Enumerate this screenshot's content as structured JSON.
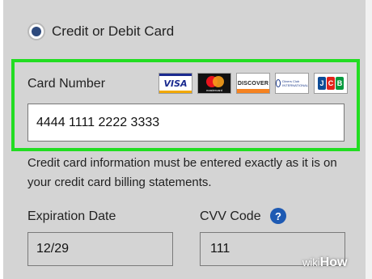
{
  "payment_method": {
    "option_label": "Credit or Debit Card",
    "selected": true
  },
  "card_number": {
    "label": "Card Number",
    "value": "4444 1111 2222 3333"
  },
  "card_logos": [
    {
      "name": "visa-logo",
      "text": "VISA"
    },
    {
      "name": "mastercard-logo",
      "text": "mastercard"
    },
    {
      "name": "discover-logo",
      "text": "DISCOVER"
    },
    {
      "name": "diners-club-logo",
      "text": "Diners Club INTERNATIONAL"
    },
    {
      "name": "jcb-logo",
      "text": "JCB"
    }
  ],
  "info_text": "Credit card information must be entered exactly as it is on your credit card billing statements.",
  "expiration": {
    "label": "Expiration Date",
    "value": "12/29"
  },
  "cvv": {
    "label": "CVV Code",
    "help_icon": "?",
    "value": "111"
  },
  "watermark": {
    "prefix": "wiki",
    "suffix": "How"
  },
  "colors": {
    "highlight": "#22dd22",
    "radio_selected": "#2e4a7d",
    "help_icon": "#1e5ab3",
    "panel_background": "#d4d4d4"
  }
}
